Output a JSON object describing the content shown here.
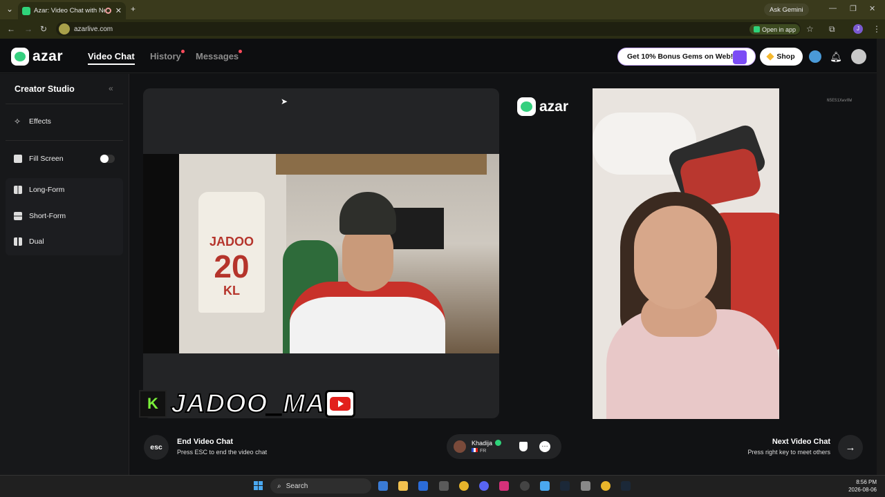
{
  "browser": {
    "tab_title": "Azar: Video Chat with New",
    "tab_close": "✕",
    "new_tab": "+",
    "ask_gemini": "Ask Gemini",
    "url": "azarlive.com",
    "open_in_app": "Open in app",
    "profile_initial": "J"
  },
  "header": {
    "logo_text": "azar",
    "nav": [
      {
        "label": "Video Chat",
        "active": true
      },
      {
        "label": "History",
        "badge": true
      },
      {
        "label": "Messages",
        "badge": true
      }
    ],
    "bonus_label": "Get 10% Bonus Gems on Web!",
    "shop_label": "Shop"
  },
  "sidebar": {
    "title": "Creator Studio",
    "collapse_icon": "«",
    "items": [
      {
        "label": "Effects",
        "icon": "magic-wand-icon"
      },
      {
        "label": "Fill Screen",
        "icon": "fill-screen-icon",
        "toggle": false
      },
      {
        "label": "Long-Form",
        "icon": "long-form-icon"
      },
      {
        "label": "Short-Form",
        "icon": "short-form-icon"
      },
      {
        "label": "Dual",
        "icon": "dual-icon"
      }
    ]
  },
  "stage": {
    "local_video": {
      "jersey_name": "JADOO",
      "jersey_number": "20",
      "jersey_initials": "KL"
    },
    "overlay_name": "JADOO_MA",
    "overlay_k": "K",
    "remote_logo": "azar",
    "watermark": "N5ES1Xwv0W"
  },
  "controls": {
    "esc_label": "esc",
    "end_title": "End Video Chat",
    "end_sub": "Press ESC to end the video chat",
    "peer_name": "Khadija",
    "peer_country": "FR",
    "chat_icon": "…",
    "next_title": "Next Video Chat",
    "next_sub": "Press right key to meet others",
    "next_arrow": "→"
  },
  "taskbar": {
    "search_label": "Search",
    "time": "8:56 PM",
    "date": "2026-08-06"
  },
  "colors": {
    "accent_green": "#35d07f",
    "badge_red": "#ff4b5c",
    "gift_purple": "#7b4cf5"
  }
}
